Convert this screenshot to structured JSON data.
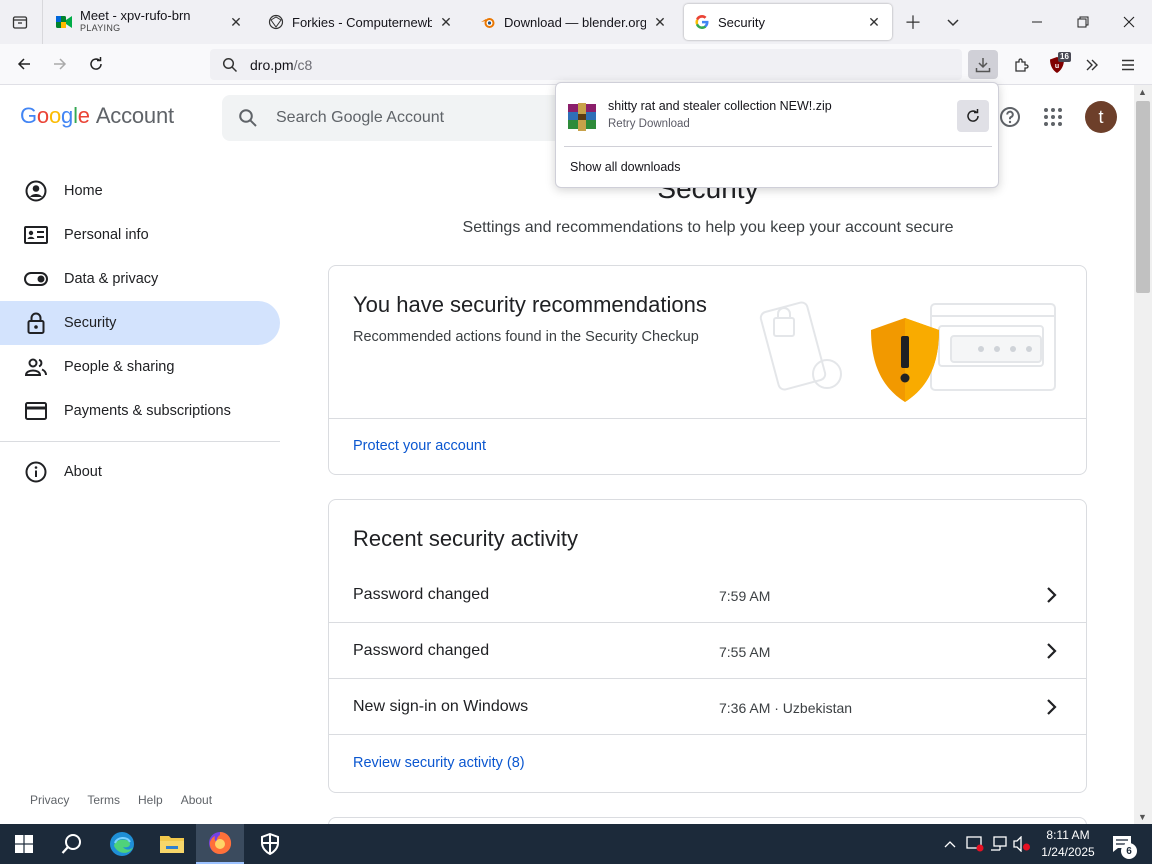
{
  "browser": {
    "tabs": [
      {
        "title": "Meet - xpv-rufo-brn",
        "subtitle": "PLAYING",
        "icon": "google-meet-icon"
      },
      {
        "title": "Forkies - Computernewb Wiki",
        "icon": "wiki-icon"
      },
      {
        "title": "Download — blender.org",
        "icon": "blender-icon"
      },
      {
        "title": "Security",
        "icon": "google-icon",
        "active": true
      }
    ],
    "url_host": "dro.pm",
    "url_path": "/c8",
    "extension_badge": "16"
  },
  "downloads_panel": {
    "file_name": "shitty rat and stealer collection NEW!.zip",
    "status": "Retry Download",
    "show_all": "Show all downloads"
  },
  "header": {
    "logo_google": "Google",
    "logo_account": "Account",
    "search_placeholder": "Search Google Account",
    "avatar_letter": "t"
  },
  "sidenav": {
    "items": [
      {
        "label": "Home",
        "icon": "account-circle-icon"
      },
      {
        "label": "Personal info",
        "icon": "id-card-icon"
      },
      {
        "label": "Data & privacy",
        "icon": "toggle-icon"
      },
      {
        "label": "Security",
        "icon": "lock-icon",
        "active": true
      },
      {
        "label": "People & sharing",
        "icon": "people-icon"
      },
      {
        "label": "Payments & subscriptions",
        "icon": "credit-card-icon"
      }
    ],
    "about": "About",
    "footer": [
      "Privacy",
      "Terms",
      "Help",
      "About"
    ]
  },
  "main": {
    "title": "Security",
    "subtitle": "Settings and recommendations to help you keep your account secure",
    "recommendations": {
      "heading": "You have security recommendations",
      "description": "Recommended actions found in the Security Checkup",
      "link": "Protect your account"
    },
    "activity": {
      "heading": "Recent security activity",
      "rows": [
        {
          "title": "Password changed",
          "time": "7:59 AM"
        },
        {
          "title": "Password changed",
          "time": "7:55 AM"
        },
        {
          "title": "New sign-in on Windows",
          "time": "7:36 AM · Uzbekistan"
        }
      ],
      "link": "Review security activity (8)"
    }
  },
  "taskbar": {
    "time": "8:11 AM",
    "date": "1/24/2025",
    "notification_count": "6"
  },
  "colors": {
    "accent_link": "#0b57d0",
    "nav_active": "#d3e3fd",
    "shield": "#f9ab00",
    "taskbar": "#1c2a3a"
  }
}
